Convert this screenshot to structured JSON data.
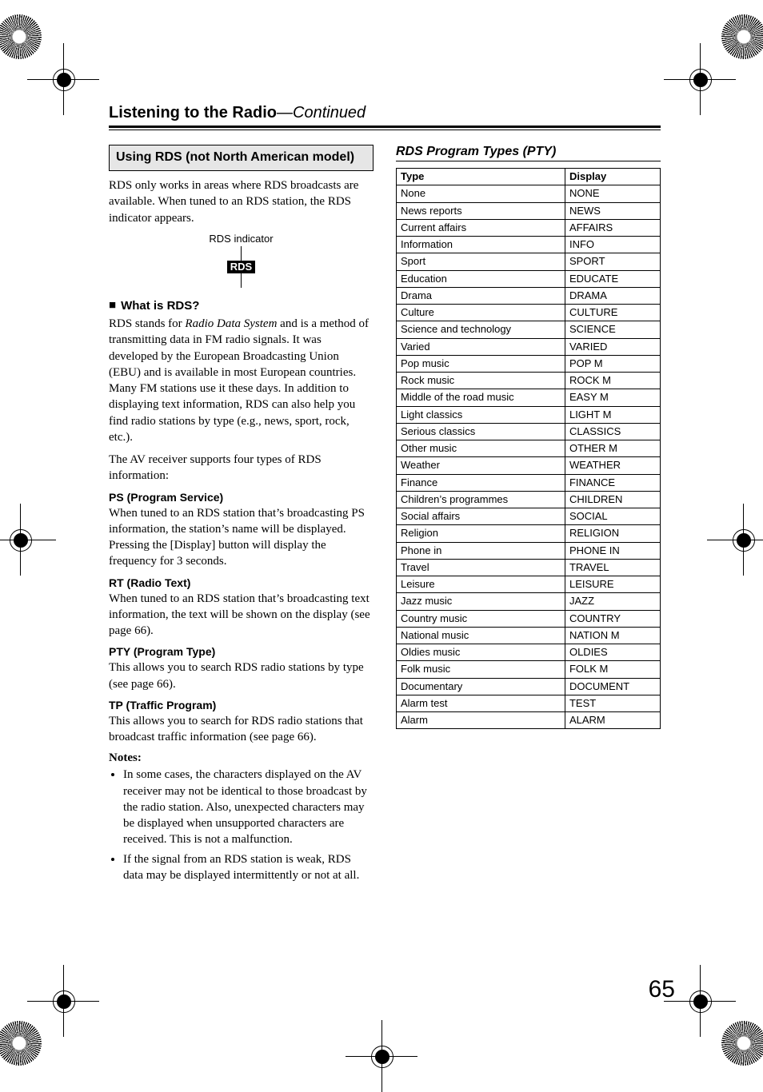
{
  "header": {
    "title": "Listening to the Radio",
    "continued": "—Continued"
  },
  "left": {
    "section_title": "Using RDS (not North American model)",
    "intro": "RDS only works in areas where RDS broadcasts are available. When tuned to an RDS station, the RDS indicator appears.",
    "indicator_label": "RDS indicator",
    "indicator_text": "RDS",
    "what_is_heading": "What is RDS?",
    "what_is_p1_a": "RDS stands for ",
    "what_is_p1_em": "Radio Data System",
    "what_is_p1_b": " and is a method of transmitting data in FM radio signals. It was developed by the European Broadcasting Union (EBU) and is available in most European countries. Many FM stations use it these days. In addition to displaying text information, RDS can also help you find radio stations by type (e.g., news, sport, rock, etc.).",
    "what_is_p2": "The AV receiver supports four types of RDS information:",
    "ps_head": "PS (Program Service)",
    "ps_body": "When tuned to an RDS station that’s broadcasting PS information, the station’s name will be displayed. Pressing the [Display] button will display the frequency for 3 seconds.",
    "rt_head": "RT (Radio Text)",
    "rt_body": "When tuned to an RDS station that’s broadcasting text information, the text will be shown on the display (see page 66).",
    "pty_head": "PTY (Program Type)",
    "pty_body": "This allows you to search RDS radio stations by type (see page 66).",
    "tp_head": "TP (Traffic Program)",
    "tp_body": "This allows you to search for RDS radio stations that broadcast traffic information (see page 66).",
    "notes_label": "Notes:",
    "notes": [
      "In some cases, the characters displayed on the AV receiver may not be identical to those broadcast by the radio station. Also, unexpected characters may be displayed when unsupported characters are received. This is not a malfunction.",
      "If the signal from an RDS station is weak, RDS data may be displayed intermittently or not at all."
    ]
  },
  "right": {
    "title": "RDS Program Types (PTY)",
    "headers": {
      "type": "Type",
      "display": "Display"
    },
    "rows": [
      {
        "type": "None",
        "display": "NONE"
      },
      {
        "type": "News reports",
        "display": "NEWS"
      },
      {
        "type": "Current affairs",
        "display": "AFFAIRS"
      },
      {
        "type": "Information",
        "display": "INFO"
      },
      {
        "type": "Sport",
        "display": "SPORT"
      },
      {
        "type": "Education",
        "display": "EDUCATE"
      },
      {
        "type": "Drama",
        "display": "DRAMA"
      },
      {
        "type": "Culture",
        "display": "CULTURE"
      },
      {
        "type": "Science and technology",
        "display": "SCIENCE"
      },
      {
        "type": "Varied",
        "display": "VARIED"
      },
      {
        "type": "Pop music",
        "display": "POP M"
      },
      {
        "type": "Rock music",
        "display": "ROCK M"
      },
      {
        "type": "Middle of the road music",
        "display": "EASY M"
      },
      {
        "type": "Light classics",
        "display": "LIGHT M"
      },
      {
        "type": "Serious classics",
        "display": "CLASSICS"
      },
      {
        "type": "Other music",
        "display": "OTHER M"
      },
      {
        "type": "Weather",
        "display": "WEATHER"
      },
      {
        "type": "Finance",
        "display": "FINANCE"
      },
      {
        "type": "Children’s programmes",
        "display": "CHILDREN"
      },
      {
        "type": "Social affairs",
        "display": "SOCIAL"
      },
      {
        "type": "Religion",
        "display": "RELIGION"
      },
      {
        "type": "Phone in",
        "display": "PHONE IN"
      },
      {
        "type": "Travel",
        "display": "TRAVEL"
      },
      {
        "type": "Leisure",
        "display": "LEISURE"
      },
      {
        "type": "Jazz music",
        "display": "JAZZ"
      },
      {
        "type": "Country music",
        "display": "COUNTRY"
      },
      {
        "type": "National music",
        "display": "NATION M"
      },
      {
        "type": "Oldies music",
        "display": "OLDIES"
      },
      {
        "type": "Folk music",
        "display": "FOLK M"
      },
      {
        "type": "Documentary",
        "display": "DOCUMENT"
      },
      {
        "type": "Alarm test",
        "display": "TEST"
      },
      {
        "type": "Alarm",
        "display": "ALARM"
      }
    ]
  },
  "page_number": "65"
}
